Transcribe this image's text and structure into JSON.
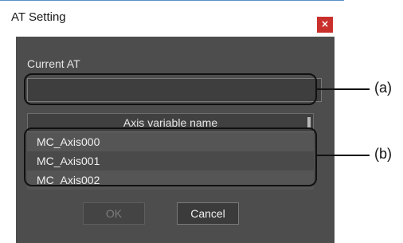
{
  "window": {
    "title": "AT Setting",
    "close_glyph": "×"
  },
  "current_at": {
    "label": "Current AT",
    "value": ""
  },
  "axis_table": {
    "header": "Axis variable name",
    "rows": [
      "MC_Axis000",
      "MC_Axis001",
      "MC_Axis002"
    ]
  },
  "buttons": {
    "ok": "OK",
    "cancel": "Cancel"
  },
  "annotations": {
    "a": "(a)",
    "b": "(b)"
  },
  "colors": {
    "close_button": "#c9302c",
    "dialog_body": "#4d4d4d",
    "title_accent": "#5b8fc7"
  }
}
